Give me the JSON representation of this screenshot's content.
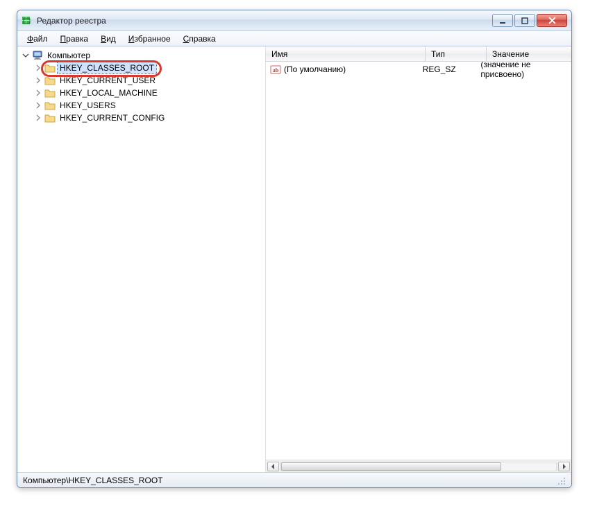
{
  "window": {
    "title": "Редактор реестра"
  },
  "menu": {
    "items": [
      {
        "u": "Ф",
        "rest": "айл"
      },
      {
        "u": "П",
        "rest": "равка"
      },
      {
        "u": "В",
        "rest": "ид"
      },
      {
        "u": "И",
        "rest": "збранное"
      },
      {
        "u": "С",
        "rest": "правка"
      }
    ]
  },
  "tree": {
    "root": "Компьютер",
    "hives": [
      "HKEY_CLASSES_ROOT",
      "HKEY_CURRENT_USER",
      "HKEY_LOCAL_MACHINE",
      "HKEY_USERS",
      "HKEY_CURRENT_CONFIG"
    ],
    "selected_index": 0
  },
  "list": {
    "headers": {
      "name": "Имя",
      "type": "Тип",
      "value": "Значение"
    },
    "rows": [
      {
        "name": "(По умолчанию)",
        "type": "REG_SZ",
        "value": "(значение не присвоено)"
      }
    ]
  },
  "status": {
    "path": "Компьютер\\HKEY_CLASSES_ROOT"
  }
}
